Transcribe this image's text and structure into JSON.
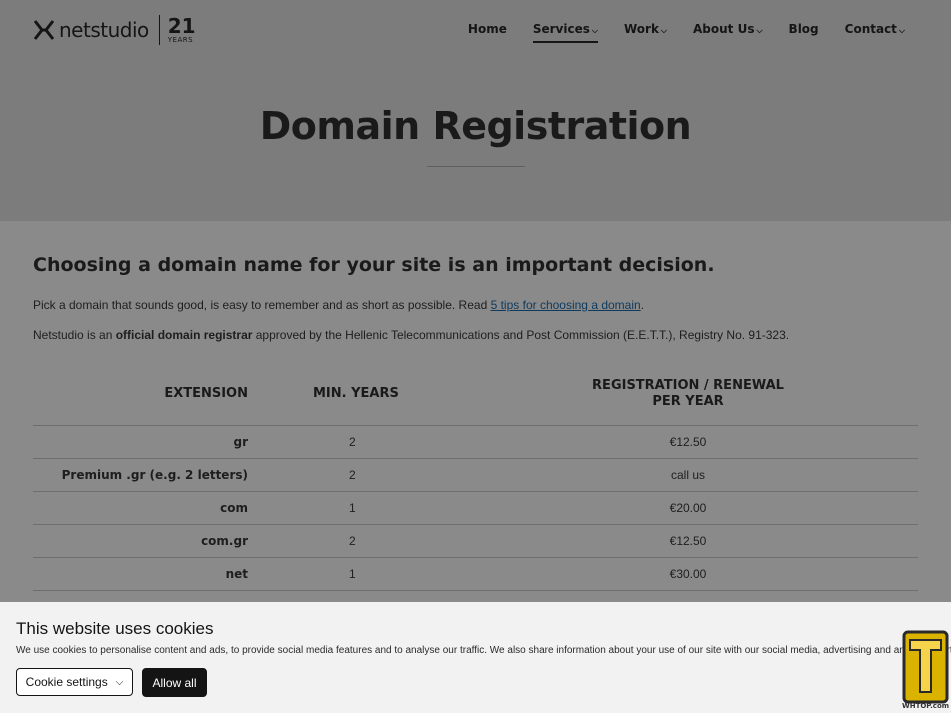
{
  "header": {
    "logo_text": "netstudio",
    "logo_years_num": "21",
    "logo_years_label": "YEARS",
    "nav": [
      {
        "label": "Home",
        "dropdown": false,
        "active": false
      },
      {
        "label": "Services",
        "dropdown": true,
        "active": true
      },
      {
        "label": "Work",
        "dropdown": true,
        "active": false
      },
      {
        "label": "About Us",
        "dropdown": true,
        "active": false
      },
      {
        "label": "Blog",
        "dropdown": false,
        "active": false
      },
      {
        "label": "Contact",
        "dropdown": true,
        "active": false
      }
    ]
  },
  "hero": {
    "title": "Domain Registration"
  },
  "content": {
    "heading": "Choosing a domain name for your site is an important decision.",
    "p1_before": "Pick a domain that sounds good, is easy to remember and as short as possible. Read ",
    "p1_link": "5 tips for choosing a domain",
    "p1_after": ".",
    "p2_before": "Netstudio is an ",
    "p2_bold": "official domain registrar",
    "p2_after": " approved by the Hellenic Telecommunications and Post Commission (E.E.T.T.), Registry No. 91-323."
  },
  "table": {
    "headers": {
      "extension": "EXTENSION",
      "min_years": "MIN. YEARS",
      "registration_line1": "REGISTRATION / RENEWAL",
      "registration_line2": "PER YEAR"
    },
    "rows": [
      {
        "ext": "gr",
        "min": "2",
        "price": "€12.50"
      },
      {
        "ext": "Premium .gr (e.g. 2 letters)",
        "min": "2",
        "price": "call us"
      },
      {
        "ext": "com",
        "min": "1",
        "price": "€20.00"
      },
      {
        "ext": "com.gr",
        "min": "2",
        "price": "€12.50"
      },
      {
        "ext": "net",
        "min": "1",
        "price": "€30.00"
      }
    ]
  },
  "cookie_banner": {
    "title": "This website uses cookies",
    "text": "We use cookies to personalise content and ads, to provide social media features and to analyse our traffic. We also share information about your use of our site with our social media, advertising and analytics partners.",
    "settings_label": "Cookie settings",
    "allow_label": "Allow all"
  },
  "watermark": {
    "text": "WHTOP.com"
  },
  "colors": {
    "overlay_bg": "#8a8a8a",
    "banner_bg": "#f2f2f2",
    "link": "#0e3a5e"
  }
}
